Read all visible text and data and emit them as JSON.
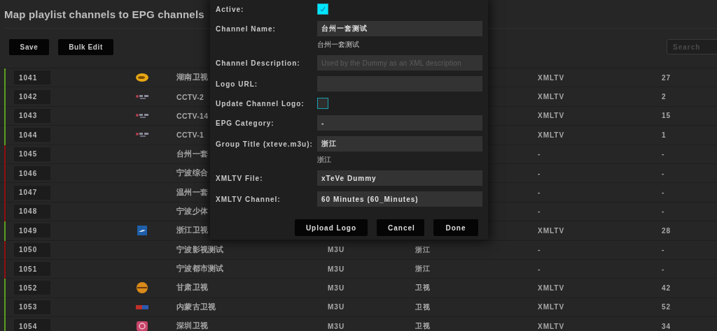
{
  "page": {
    "title": "Map playlist channels to EPG channels"
  },
  "toolbar": {
    "buttons": [
      "Save",
      "Bulk Edit"
    ],
    "search": {
      "placeholder": "Search"
    }
  },
  "table": {
    "rows": [
      {
        "number": "1041",
        "active": true,
        "logo": true,
        "name": "湖南卫视",
        "xmltv": "XMLTV",
        "channel": "27"
      },
      {
        "number": "1042",
        "active": true,
        "logo": true,
        "name": "CCTV-2",
        "xmltv": "XMLTV",
        "channel": "2"
      },
      {
        "number": "1043",
        "active": true,
        "logo": true,
        "name": "CCTV-14",
        "xmltv": "XMLTV",
        "channel": "15"
      },
      {
        "number": "1044",
        "active": true,
        "logo": true,
        "name": "CCTV-1",
        "xmltv": "XMLTV",
        "channel": "1"
      },
      {
        "number": "1045",
        "active": false,
        "name": "台州一套",
        "xmltv": "-",
        "channel": "-"
      },
      {
        "number": "1046",
        "active": false,
        "name": "宁波综合",
        "xmltv": "-",
        "channel": "-"
      },
      {
        "number": "1047",
        "active": false,
        "name": "温州一套",
        "xmltv": "-",
        "channel": "-"
      },
      {
        "number": "1048",
        "active": false,
        "name": "宁波少体",
        "xmltv": "-",
        "channel": "-"
      },
      {
        "number": "1049",
        "active": true,
        "logo": true,
        "name": "浙江卫视",
        "xmltv": "XMLTV",
        "channel": "28"
      },
      {
        "number": "1050",
        "active": false,
        "name": "宁波影视测试",
        "source": "M3U",
        "group": "浙江",
        "xmltv": "-",
        "channel": "-"
      },
      {
        "number": "1051",
        "active": false,
        "name": "宁波都市测试",
        "source": "M3U",
        "group": "浙江",
        "xmltv": "-",
        "channel": "-"
      },
      {
        "number": "1052",
        "active": true,
        "logo": true,
        "name": "甘肃卫视",
        "source": "M3U",
        "group": "卫视",
        "xmltv": "XMLTV",
        "channel": "42"
      },
      {
        "number": "1053",
        "active": true,
        "logo": true,
        "name": "内蒙古卫视",
        "source": "M3U",
        "group": "卫视",
        "xmltv": "XMLTV",
        "channel": "52"
      },
      {
        "number": "1054",
        "active": true,
        "logo": true,
        "name": "深圳卫视",
        "source": "M3U",
        "group": "卫视",
        "xmltv": "XMLTV",
        "channel": "34"
      }
    ]
  },
  "dialog": {
    "fields": [
      {
        "kind": "checkbox",
        "label": "Active:",
        "checked": true
      },
      {
        "kind": "input",
        "label": "Channel Name:",
        "value": "台州一套测试",
        "hint": "台州一套测试"
      },
      {
        "kind": "input",
        "label": "Channel Description:",
        "placeholder": "Used by the Dummy as an XML description"
      },
      {
        "kind": "input",
        "label": "Logo URL:"
      },
      {
        "kind": "checkbox",
        "label": "Update Channel Logo:",
        "checked": false
      },
      {
        "kind": "select",
        "label": "EPG Category:",
        "value": "-"
      },
      {
        "kind": "input",
        "label": "Group Title (xteve.m3u):",
        "value": "浙江",
        "hint": "浙江"
      },
      {
        "kind": "select",
        "label": "XMLTV File:",
        "value": "xTeVe Dummy"
      },
      {
        "kind": "select",
        "label": "XMLTV Channel:",
        "value": "60 Minutes (60_Minutes)"
      }
    ],
    "buttons": [
      "Upload Logo",
      "Cancel",
      "Done"
    ]
  }
}
